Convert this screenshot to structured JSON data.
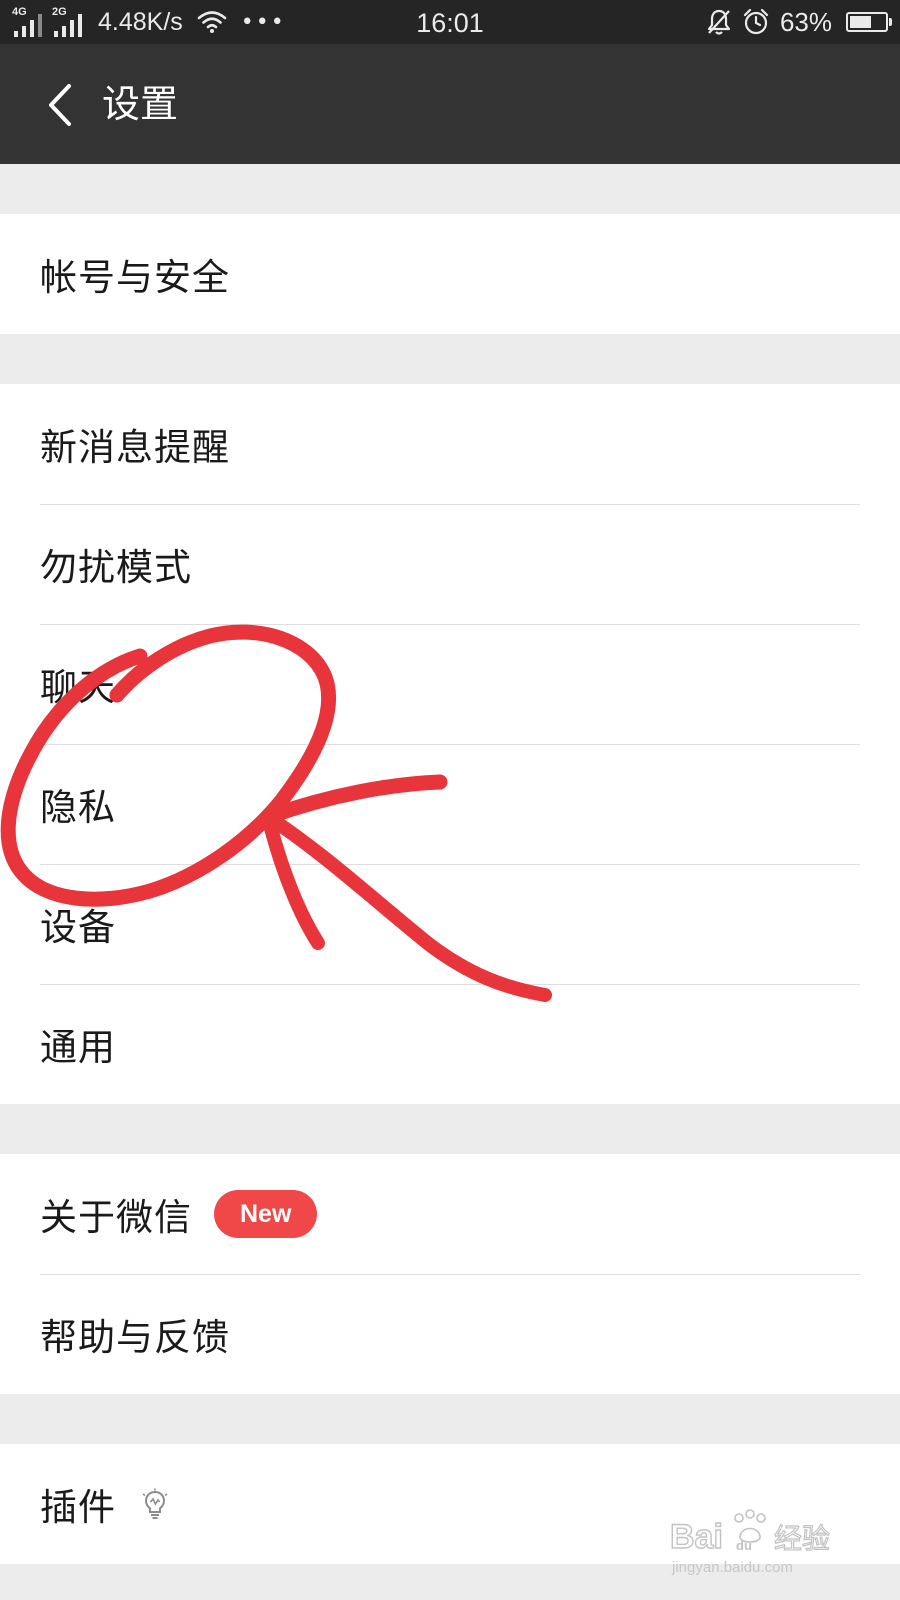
{
  "status_bar": {
    "sim1_tag": "4G",
    "sim2_tag": "2G",
    "net_speed": "4.48K/s",
    "more_dots": "•••",
    "time": "16:01",
    "battery_percent": "63%",
    "battery_level": 0.63
  },
  "header": {
    "title": "设置"
  },
  "groups": [
    {
      "items": [
        {
          "label": "帐号与安全"
        }
      ]
    },
    {
      "items": [
        {
          "label": "新消息提醒"
        },
        {
          "label": "勿扰模式"
        },
        {
          "label": "聊天"
        },
        {
          "label": "隐私"
        },
        {
          "label": "设备"
        },
        {
          "label": "通用"
        }
      ]
    },
    {
      "items": [
        {
          "label": "关于微信",
          "badge": "New"
        },
        {
          "label": "帮助与反馈"
        }
      ]
    },
    {
      "items": [
        {
          "label": "插件",
          "icon": "bulb-icon"
        }
      ]
    }
  ],
  "colors": {
    "status_bar": "#252525",
    "title_bar": "#333333",
    "badge": "#f04848",
    "annotation": "#e8353b",
    "background": "#ececec"
  }
}
